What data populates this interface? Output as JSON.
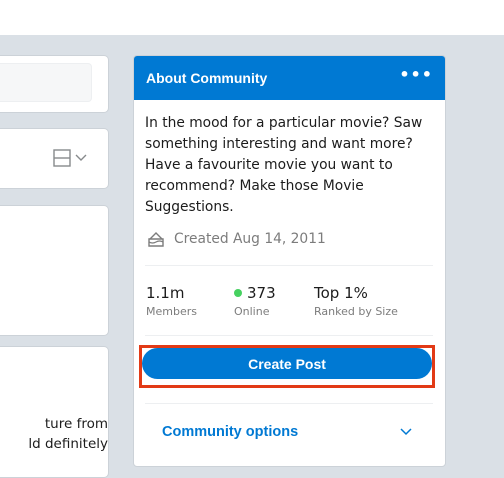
{
  "post_snippet": {
    "line1": "ture from",
    "line2": "ld definitely"
  },
  "about": {
    "title": "About Community",
    "more_icon": "•••",
    "description": "In the mood for a particular movie? Saw something interesting and want more? Have a favourite movie you want to recommend? Make those Movie Suggestions.",
    "created": "Created Aug 14, 2011",
    "stats": [
      {
        "value": "1.1m",
        "label": "Members"
      },
      {
        "value": "373",
        "label": "Online"
      },
      {
        "value": "Top 1%",
        "label": "Ranked by Size"
      }
    ],
    "create_post_label": "Create Post",
    "options_label": "Community options"
  },
  "colors": {
    "brand_blue": "#0079d3",
    "online_green": "#46d160",
    "highlight_red": "#e23a16",
    "page_bg": "#dae0e6"
  },
  "icons": {
    "created": "cake-icon",
    "layout": "card-layout-icon",
    "dropdown": "chevron-down-icon",
    "more": "more-options-icon"
  }
}
